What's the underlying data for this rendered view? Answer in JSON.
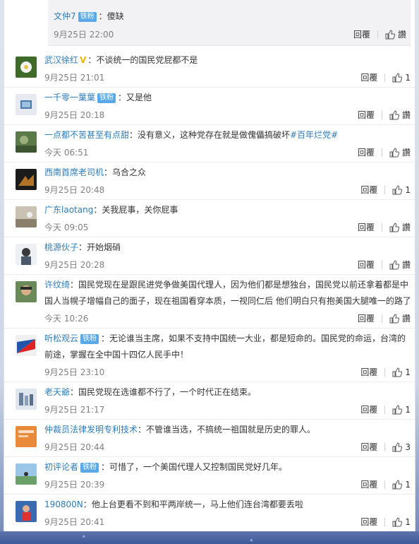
{
  "reply": {
    "user": "文仲7",
    "badge": "铁粉",
    "sep": "：",
    "text": "傻缺",
    "time": "9月25日 22:00",
    "reply_label": "回覆",
    "like_label": "讚"
  },
  "comments": [
    {
      "user": "武汉徐红",
      "badge": "",
      "verified": "V",
      "sep": "：",
      "text": "不谈统一的国民党屁都不是",
      "hashtag": "",
      "time": "9月25日 21:01",
      "reply_label": "回覆",
      "like": "1"
    },
    {
      "user": "一千零一葉葉",
      "badge": "铁粉",
      "verified": "",
      "sep": "：",
      "text": "又是他",
      "hashtag": "",
      "time": "9月25日 20:18",
      "reply_label": "回覆",
      "like": "讚"
    },
    {
      "user": "一点都不苦甚至有点甜",
      "badge": "",
      "verified": "",
      "sep": "：",
      "text": "没有意义，这种党存在就是做傀儡搞破坏",
      "hashtag": "#百年烂党#",
      "time": "今天 06:51",
      "reply_label": "回覆",
      "like": "讚"
    },
    {
      "user": "西南首席老司机",
      "badge": "",
      "verified": "",
      "sep": "：",
      "text": "乌合之众",
      "hashtag": "",
      "time": "9月25日 20:48",
      "reply_label": "回覆",
      "like": "1"
    },
    {
      "user": "广东laotang",
      "badge": "",
      "verified": "",
      "sep": "：",
      "text": "关我屁事，关你屁事",
      "hashtag": "",
      "time": "今天 09:05",
      "reply_label": "回覆",
      "like": "讚"
    },
    {
      "user": "桃源伙子",
      "badge": "",
      "verified": "",
      "sep": "：",
      "text": "开始烟硝",
      "hashtag": "",
      "time": "9月25日 20:28",
      "reply_label": "回覆",
      "like": "讚"
    },
    {
      "user": "许纹绮",
      "badge": "",
      "verified": "",
      "sep": "：",
      "text": "国民党现在是跟民进党争做美国代理人，因为他们都是想独台，国民党以前还拿着都是中国人当幌子增幅自己的面子，现在祖国看穿本质，一视同仁后 他们明白只有抱美国大腿唯一的路了",
      "hashtag": "",
      "time": "今天 10:26",
      "reply_label": "回覆",
      "like": "讚"
    },
    {
      "user": "听松观云",
      "badge": "铁粉",
      "verified": "",
      "sep": "：",
      "text": "无论谁当主席，如果不支持中国统一大业，都是短命的。国民党的命运，台湾的前途，掌握在全中国十四亿人民手中！",
      "hashtag": "",
      "time": "9月25日 23:10",
      "reply_label": "回覆",
      "like": "1"
    },
    {
      "user": "老天爺",
      "badge": "",
      "verified": "",
      "sep": "：",
      "text": "国民党现在选谁都不行了，一个时代正在结束。",
      "hashtag": "",
      "time": "9月25日 21:17",
      "reply_label": "回覆",
      "like": "1"
    },
    {
      "user": "仲裁员法律发明专利技术",
      "badge": "",
      "verified": "",
      "sep": "：",
      "text": "不管谁当选，不搞统一祖国就是历史的罪人。",
      "hashtag": "",
      "time": "9月25日 20:44",
      "reply_label": "回覆",
      "like": "3"
    },
    {
      "user": "初评论者",
      "badge": "铁粉",
      "verified": "",
      "sep": "：",
      "text": "可惜了，一个美国代理人又控制国民党好几年。",
      "hashtag": "",
      "time": "9月25日 20:39",
      "reply_label": "回覆",
      "like": "1"
    },
    {
      "user": "190800N",
      "badge": "",
      "verified": "",
      "sep": "：",
      "text": "他上台更看不到和平两岸统一，马上他们连台湾都要丢啦",
      "hashtag": "",
      "time": "9月25日 20:41",
      "reply_label": "回覆",
      "like": "1"
    }
  ]
}
